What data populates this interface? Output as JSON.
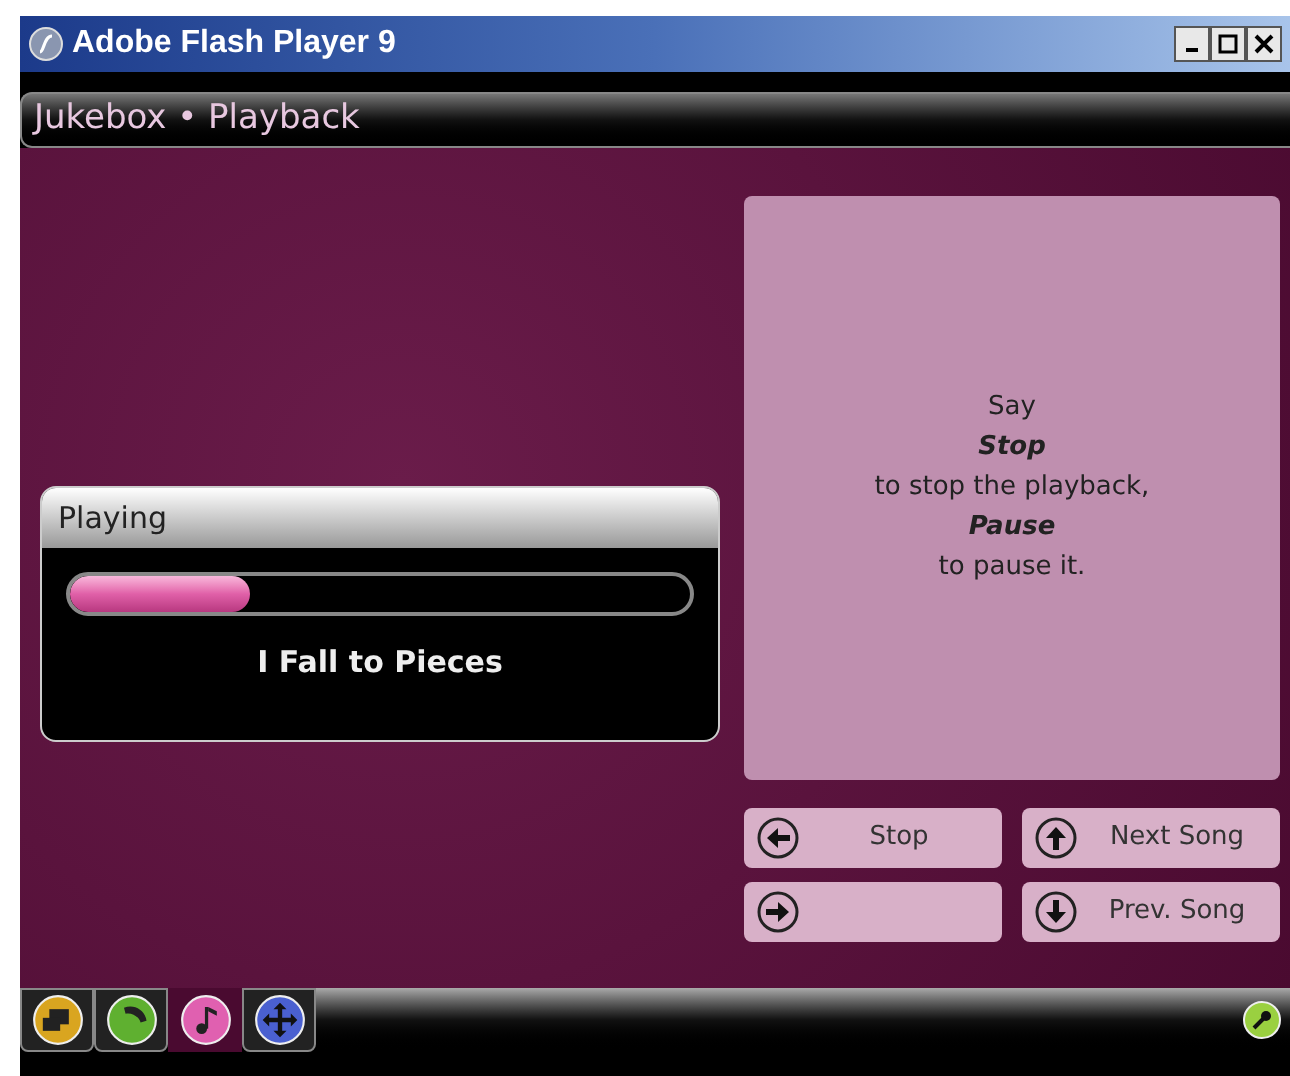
{
  "window": {
    "title": "Adobe Flash Player 9"
  },
  "header": {
    "title": "Jukebox • Playback"
  },
  "player": {
    "title": "Playing",
    "level": 0.29,
    "song": "I Fall to Pieces"
  },
  "instructions": [
    {
      "kind": "text",
      "text": "Say"
    },
    {
      "kind": "command",
      "text": "Stop"
    },
    {
      "kind": "text",
      "text": "to stop the playback,"
    },
    {
      "kind": "command",
      "text": "Pause"
    },
    {
      "kind": "text",
      "text": "to pause it."
    }
  ],
  "buttons": [
    {
      "kind": "left",
      "label": "Stop"
    },
    {
      "kind": "up",
      "label": "Next Song"
    },
    {
      "kind": "right"
    },
    {
      "kind": "down",
      "label": "Prev. Song"
    }
  ],
  "dock": [
    {
      "kind": "monitors",
      "color": "#d9a520",
      "selected": false
    },
    {
      "kind": "phone",
      "color": "#5fb030",
      "selected": false
    },
    {
      "kind": "music",
      "color": "#e060b0",
      "selected": true
    },
    {
      "kind": "move",
      "color": "#4a60d0",
      "selected": false
    }
  ]
}
